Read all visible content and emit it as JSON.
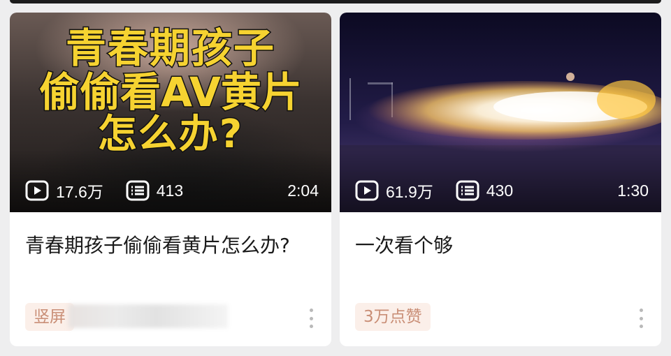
{
  "cards": [
    {
      "thumb_overlay": [
        "青春期孩子",
        "偷偷看AV黄片",
        "怎么办?"
      ],
      "plays": "17.6万",
      "comments": "413",
      "duration": "2:04",
      "title": "青春期孩子偷偷看黄片怎么办?",
      "tag": "竖屏"
    },
    {
      "plays": "61.9万",
      "comments": "430",
      "duration": "1:30",
      "title": "一次看个够",
      "tag": "3万点赞"
    }
  ],
  "icons": {
    "play": "play-icon",
    "comments": "danmaku-list-icon",
    "more": "more-vertical-icon"
  },
  "colors": {
    "overlay_text": "#f6d331",
    "tag_bg": "#fbefe9",
    "tag_text": "#c98e76",
    "page_bg": "#eeeeef"
  }
}
